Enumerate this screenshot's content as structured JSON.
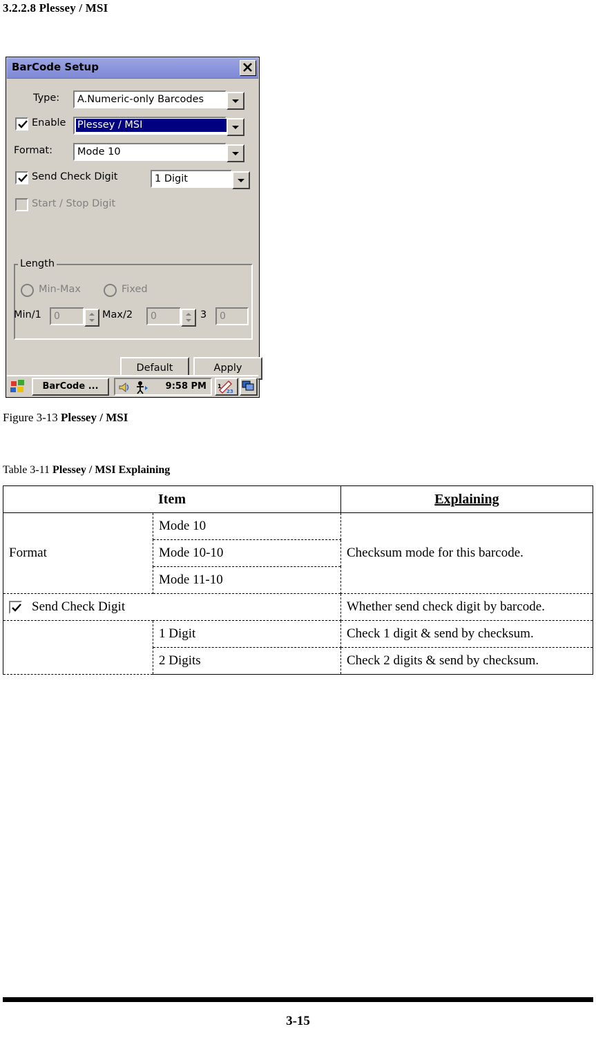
{
  "heading": "3.2.2.8 Plessey / MSI",
  "dialog": {
    "title": "BarCode Setup",
    "close_icon": "close-icon",
    "fields": {
      "type_label": "Type:",
      "type_value": "A.Numeric-only Barcodes",
      "enable_label": "Enable",
      "enable_checked": true,
      "enable_value": "Plessey / MSI",
      "format_label": "Format:",
      "format_value": "Mode 10",
      "send_check_digit_label": "Send Check Digit",
      "send_check_digit_checked": true,
      "send_check_digit_value": "1 Digit",
      "start_stop_label": "Start / Stop Digit",
      "start_stop_checked": false
    },
    "length": {
      "group_label": "Length",
      "min_max_label": "Min-Max",
      "fixed_label": "Fixed",
      "min_label": "Min/1",
      "min_value": "0",
      "max_label": "Max/2",
      "max_value": "0",
      "third_label": "3",
      "third_value": "0"
    },
    "buttons": {
      "default": "Default",
      "apply": "Apply"
    },
    "taskbar": {
      "start_icon": "windows-start-icon",
      "task_label": "BarCode ...",
      "tray_icons": [
        "speaker-icon",
        "keyboard-person-icon"
      ],
      "clock": "9:58 PM",
      "pen_icon": "input-panel-icon",
      "desktop_icon": "show-desktop-icon"
    }
  },
  "figure_caption": {
    "prefix": "Figure 3-13 ",
    "bold": "Plessey / MSI"
  },
  "table_caption": {
    "prefix": "Table 3-11 ",
    "bold": "Plessey / MSI Explaining"
  },
  "table": {
    "headers": [
      "Item",
      "Explaining"
    ],
    "rows": [
      {
        "item": "Format",
        "options": [
          {
            "label": "Mode 10",
            "bold": true
          },
          {
            "label": "Mode 10-10",
            "bold": false
          },
          {
            "label": "Mode 11-10",
            "bold": false
          }
        ],
        "explaining": "Checksum mode for this barcode."
      },
      {
        "item": "Send Check Digit",
        "has_checkbox": true,
        "explaining": "Whether send check digit by barcode.",
        "options": [
          {
            "label": "1 Digit",
            "bold": true,
            "explaining": "Check 1 digit & send by checksum."
          },
          {
            "label": "2 Digits",
            "bold": false,
            "explaining": "Check 2 digits & send by checksum."
          }
        ]
      }
    ]
  },
  "footer": {
    "page_number": "3-15"
  }
}
